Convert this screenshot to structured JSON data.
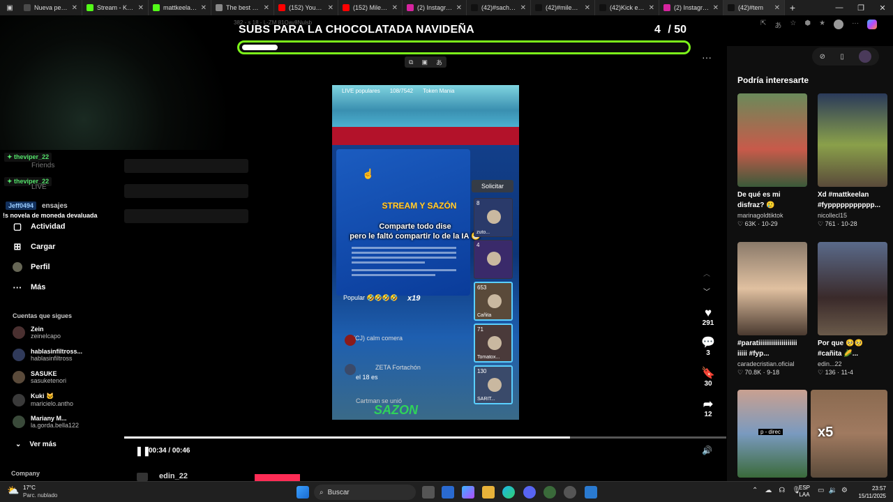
{
  "tabs": [
    {
      "label": "Nueva pestaña",
      "color": "#4a4a4a"
    },
    {
      "label": "Stream - Kick",
      "color": "#53fc18"
    },
    {
      "label": "mattkeelan St",
      "color": "#53fc18"
    },
    {
      "label": "The best Chat",
      "color": "#888888"
    },
    {
      "label": "(152) YouTube",
      "color": "#ff0000"
    },
    {
      "label": "(152) Milenka",
      "color": "#ff0000"
    },
    {
      "label": "(2) Instagram",
      "color": "#d6249f"
    },
    {
      "label": "(42)#sachauz",
      "color": "#111111"
    },
    {
      "label": "(42)#milenka",
      "color": "#111111"
    },
    {
      "label": "(42)Kick elimi",
      "color": "#111111"
    },
    {
      "label": "(2) Instagram",
      "color": "#d6249f"
    },
    {
      "label": "(42)#tem",
      "color": "#111111"
    }
  ],
  "url_fragment": "382 - s 18 - L-ZM 81Qay8Nulsb",
  "banner": {
    "title": "SUBS PARA LA CHOCOLATADA NAVIDEÑA",
    "count": "4",
    "total": "/ 50",
    "progress_fraction": 0.08,
    "accent": "#7cf51a"
  },
  "chat": {
    "badge1": "theviper_22",
    "badge2": "theviper_22",
    "badge3": "Jeff0494",
    "message": "novela de moneda devaluada",
    "faded1": "Friends",
    "faded2": "LIVE",
    "faded3": "ensajes"
  },
  "nav": [
    {
      "label": "Actividad",
      "icon": "activity-icon"
    },
    {
      "label": "Cargar",
      "icon": "upload-icon"
    },
    {
      "label": "Perfil",
      "icon": "profile-icon"
    },
    {
      "label": "Más",
      "icon": "more-icon"
    }
  ],
  "following": {
    "heading": "Cuentas que sigues",
    "accounts": [
      {
        "name": "Zein",
        "handle": "zeinelcapo"
      },
      {
        "name": "hablasinfiltross...",
        "handle": "hablasinfiltross"
      },
      {
        "name": "SASUKE",
        "handle": "sasuketenori"
      },
      {
        "name": "Kuki 🐱",
        "handle": "maricielo.antho"
      },
      {
        "name": "Mariany M...",
        "handle": "la.gorda.bella122"
      }
    ],
    "see_more": "Ver más",
    "company": "Company"
  },
  "video": {
    "top_row": [
      "LIVE populares",
      "108/7542",
      "Token Mania"
    ],
    "solicitar": "Solicitar",
    "stream_logo": "STREAM Y SAZÓN",
    "caption_line1": "Comparte todo dise",
    "caption_line2": "pero le faltó compartir lo de la IA 😁",
    "popular": "Popular 🤣🤣🤣🤣",
    "multiplier": "x19",
    "chat_lines": [
      "(CJ) calm comera",
      "ZETA Fortachón",
      "el 18 es",
      "Cartman se unió"
    ],
    "guests": [
      {
        "count": "8",
        "name": "zuto..."
      },
      {
        "count": "4",
        "name": ""
      },
      {
        "count": "653",
        "name": "Cañita"
      },
      {
        "count": "71",
        "name": "Tomatox..."
      },
      {
        "count": "130",
        "name": "SARIT..."
      }
    ]
  },
  "actions": {
    "likes": "291",
    "comments": "3",
    "saves": "30",
    "shares": "12"
  },
  "player": {
    "time": "00:34 / 00:46",
    "progress_fraction": 0.74,
    "author": "edin_22"
  },
  "recommend": {
    "title": "Podría interesarte",
    "cards": [
      {
        "title": "De qué es mi disfraz? 🥲",
        "user": "marinagoldtiktok",
        "stats": "♡ 63K · 10-29"
      },
      {
        "title": "Xd #mattkeelan #fyppppppppppp...",
        "user": "nicollecl15",
        "stats": "♡ 761 · 10-28"
      },
      {
        "title": "#paratiiiiiiiiiiiiiiiiiiii iiiii #fyp...",
        "user": "caradecristian.oficial",
        "stats": "♡ 70.8K · 9-18"
      },
      {
        "title": "Por que 🥺🥺 #cañita 🌽...",
        "user": "edin...22",
        "stats": "♡ 136 · 11-4"
      }
    ],
    "overlay_x5": "x5",
    "overlay_tag": "p - direc"
  },
  "taskbar": {
    "weather_temp": "17°C",
    "weather_desc": "Parc. nublado",
    "search": "Buscar",
    "lang1": "ESP",
    "lang2": "LAA",
    "time": "23:57",
    "date": "15/11/2025"
  }
}
